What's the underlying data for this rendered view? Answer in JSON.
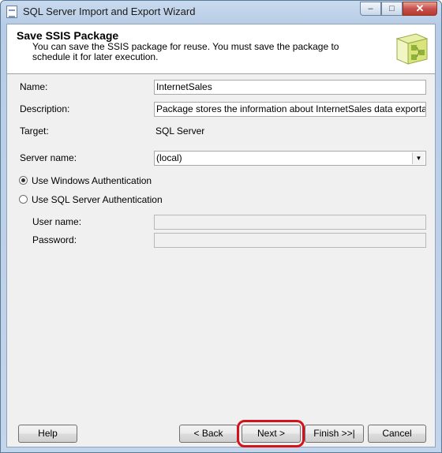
{
  "window": {
    "title": "SQL Server Import and Export Wizard"
  },
  "header": {
    "title": "Save SSIS Package",
    "description": "You can save the SSIS package for reuse. You must save the package to schedule it for later execution."
  },
  "form": {
    "name_label": "Name:",
    "name_value": "InternetSales",
    "description_label": "Description:",
    "description_value": "Package stores the information about InternetSales data exportation",
    "target_label": "Target:",
    "target_value": "SQL Server",
    "server_label": "Server name:",
    "server_value": "(local)",
    "auth_windows_label": "Use Windows Authentication",
    "auth_windows_selected": true,
    "auth_sql_label": "Use SQL Server Authentication",
    "auth_sql_selected": false,
    "username_label": "User name:",
    "username_value": "",
    "password_label": "Password:",
    "password_value": ""
  },
  "buttons": {
    "help": "Help",
    "back": "< Back",
    "next": "Next >",
    "finish": "Finish >>|",
    "cancel": "Cancel"
  },
  "icons": {
    "window_controls": [
      "minimize-icon",
      "maximize-icon",
      "close-icon"
    ],
    "header": "package-wizard-icon"
  },
  "colors": {
    "highlight": "#d2141a"
  }
}
